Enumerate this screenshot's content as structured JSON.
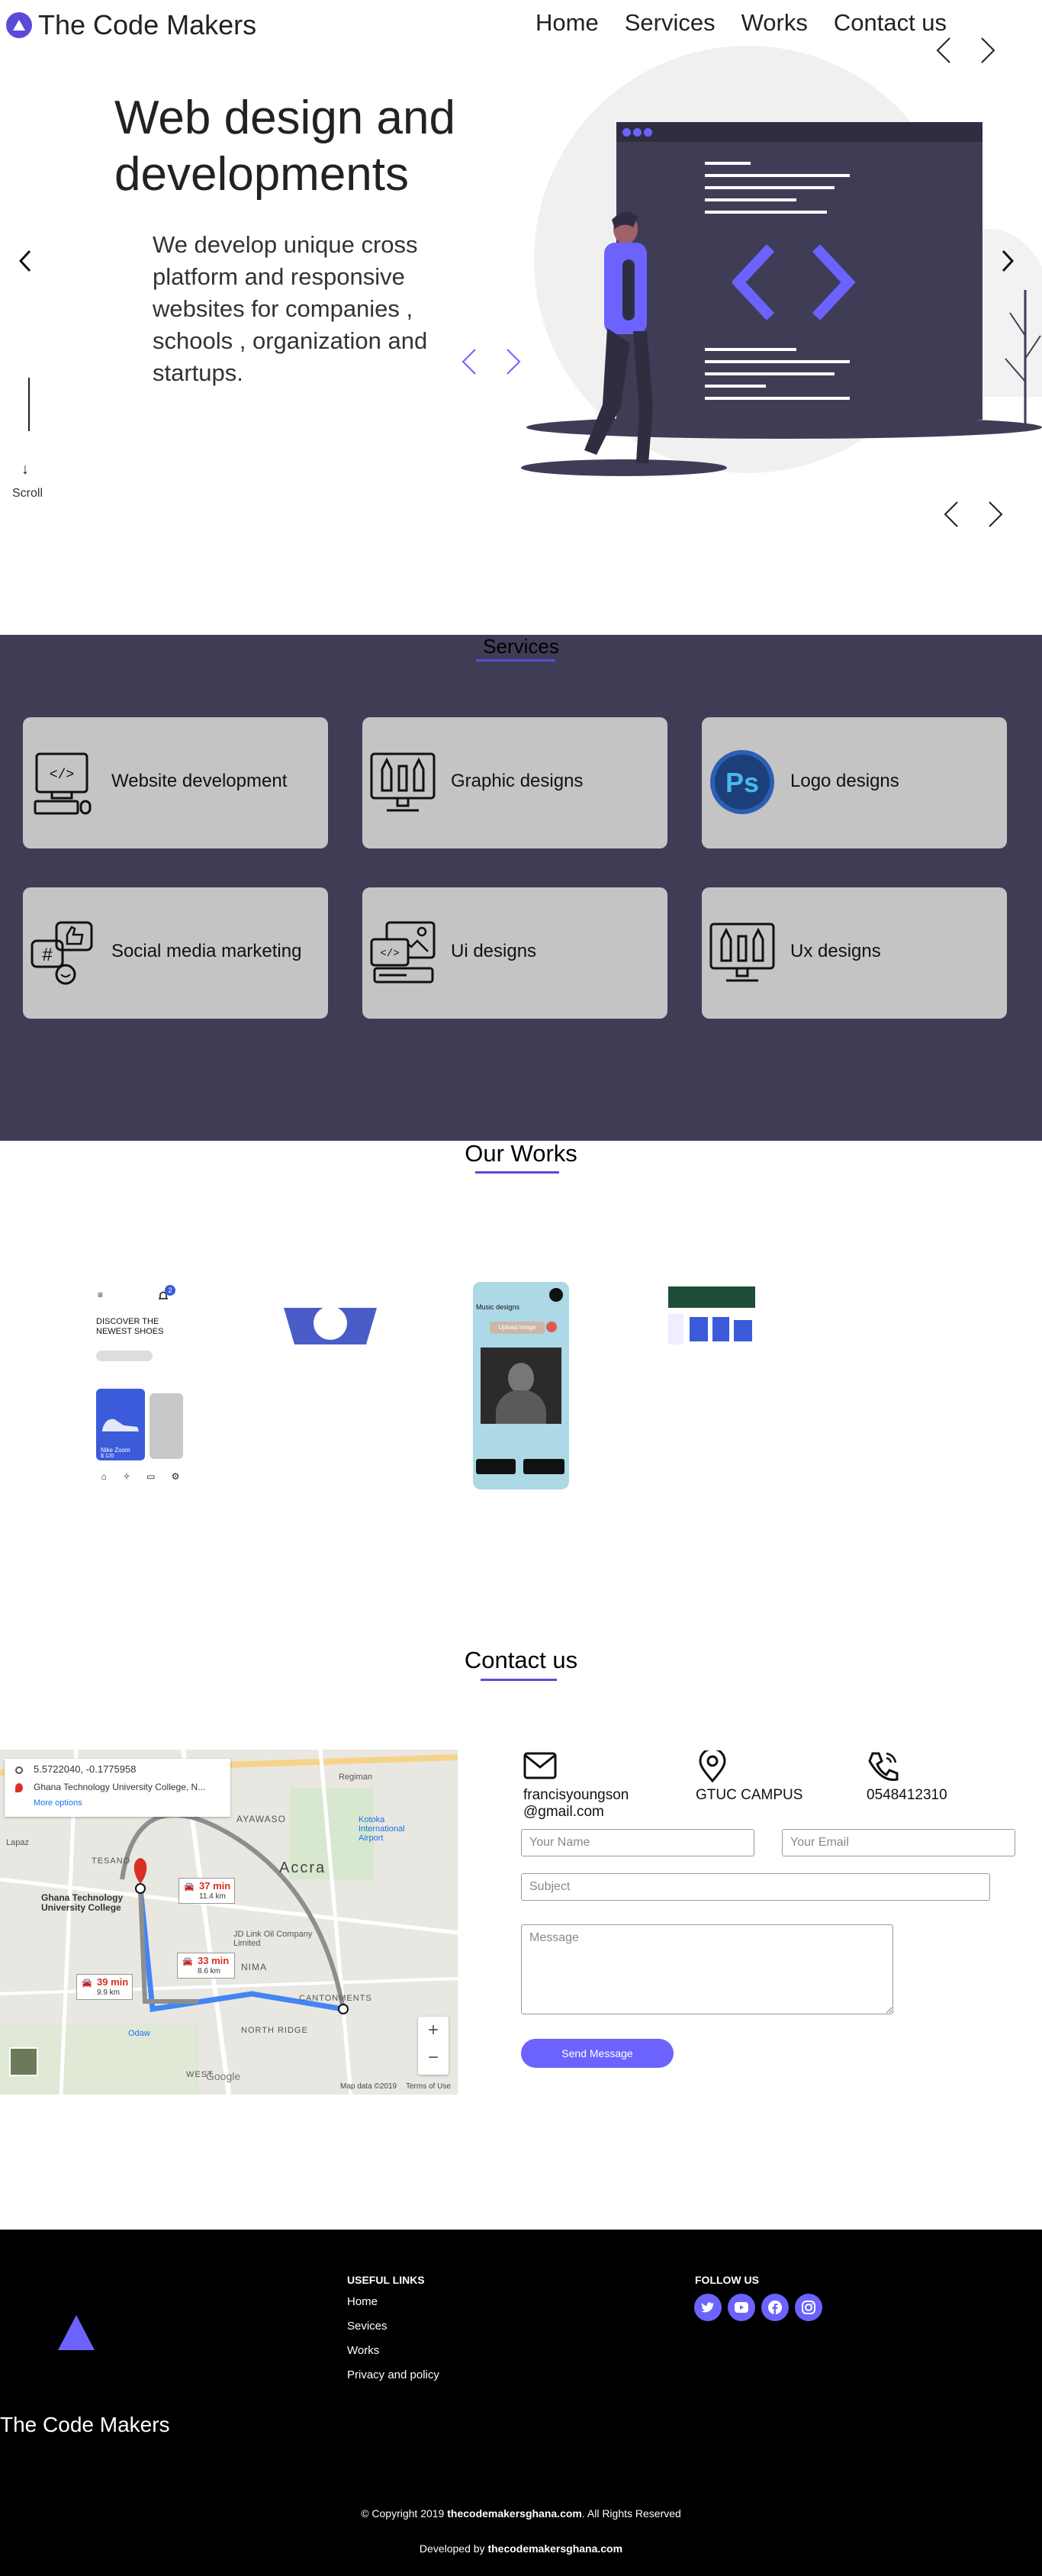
{
  "header": {
    "brand": "The Code Makers",
    "nav": [
      "Home",
      "Services",
      "Works",
      "Contact us"
    ]
  },
  "hero": {
    "title_line1": "Web design and",
    "title_line2": "developments",
    "description": "We develop unique cross platform and responsive websites for companies , schools , organization and startups.",
    "scroll_label": "Scroll"
  },
  "services": {
    "title": "Services",
    "items": [
      {
        "label": "Website development",
        "icon": "computer-code-icon"
      },
      {
        "label": "Graphic designs",
        "icon": "design-tools-monitor-icon"
      },
      {
        "label": "Logo designs",
        "icon": "photoshop-icon",
        "icon_text": "Ps"
      },
      {
        "label": "Social media marketing",
        "icon": "social-media-icon"
      },
      {
        "label": "Ui designs",
        "icon": "ui-layout-icon"
      },
      {
        "label": "Ux designs",
        "icon": "ux-tools-monitor-icon"
      }
    ]
  },
  "works": {
    "title": "Our Works",
    "shoe_app": {
      "heading_line1": "DISCOVER THE",
      "heading_line2": "NEWEST SHOES",
      "product_name": "Nike Zoom",
      "product_price": "$ 120",
      "badge": "2"
    },
    "music_app": {
      "header": "Music designs",
      "button": "Upload image"
    }
  },
  "contact": {
    "title": "Contact us",
    "email": "francisyoungson\n@gmail.com",
    "location": "GTUC CAMPUS",
    "phone": "0548412310",
    "name_placeholder": "Your Name",
    "email_placeholder": "Your Email",
    "subject_placeholder": "Subject",
    "message_placeholder": "Message",
    "send_label": "Send Message"
  },
  "map": {
    "coords": "5.5722040, -0.1775958",
    "destination": "Ghana Technology University College, N...",
    "more_options": "More options",
    "routes": [
      {
        "time": "37 min",
        "distance": "11.4 km"
      },
      {
        "time": "33 min",
        "distance": "8.6 km"
      },
      {
        "time": "39 min",
        "distance": "9.9 km"
      }
    ],
    "place_accra": "Accra",
    "place_ayawaso": "AYAWASO",
    "place_tesano": "TESANO",
    "place_nima": "NIMA",
    "place_north_ridge": "NORTH RIDGE",
    "place_cantonments": "CANTONMENTS",
    "place_airport": "Kotoka International Airport",
    "place_regimanuel": "Regiman",
    "place_lapaz": "Lapaz",
    "place_weija": "WEST",
    "place_ghana_tech": "Ghana Technology University College",
    "place_jd": "JD Link Oil Company Limited",
    "place_odaw": "Odaw",
    "google": "Google",
    "attribution": "Map data ©2019",
    "terms": "Terms of Use",
    "zoom_in": "+",
    "zoom_out": "−"
  },
  "footer": {
    "brand": "The Code Makers",
    "useful_links_title": "USEFUL LINKS",
    "links": [
      "Home",
      "Sevices",
      "Works",
      "Privacy and policy"
    ],
    "follow_title": "FOLLOW US",
    "copyright_prefix": "© Copyright 2019",
    "copyright_site": "thecodemakersghana.com",
    "copyright_suffix": ". All Rights Reserved",
    "developed_prefix": "Developed by",
    "developed_site": "thecodemakersghana.com"
  },
  "colors": {
    "accent": "#5b4bd8",
    "accent_light": "#6c63ff",
    "services_bg": "#3f3d56",
    "card_bg": "#c4c4c4",
    "footer_bg": "#000000"
  }
}
